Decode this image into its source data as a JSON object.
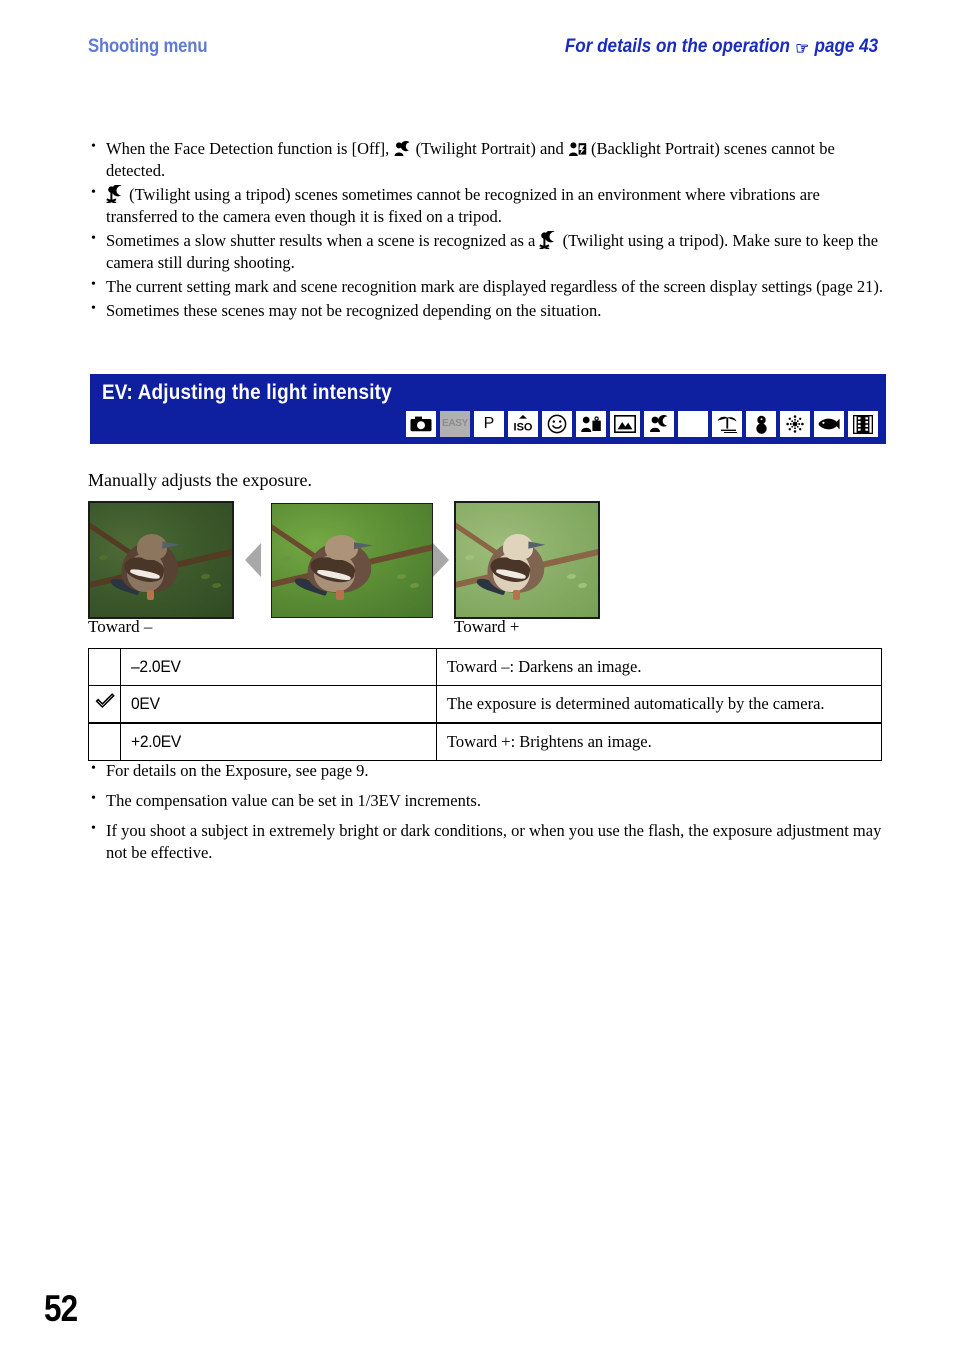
{
  "header": {
    "left_title": "Shooting menu",
    "right_title_a": "For details on the operation",
    "hand_icon": "☞",
    "right_title_b": "page 43"
  },
  "notes_top": [
    "When the Face Detection function is [Off],  (Twilight Portrait) and  (Backlight Portrait) scenes cannot be detected.",
    "(Twilight using a tripod) scenes sometimes cannot be recognized in an environment where vibrations are transferred to the camera even though it is fixed on a tripod.",
    "Sometimes a slow shutter results when a scene is recognized as a (Twilight using a tripod). Make sure to keep the camera still during shooting.",
    "The current setting mark and scene recognition mark are displayed regardless of the screen display settings (page 21).",
    "Sometimes these scenes may not be recognized depending on the situation."
  ],
  "notes_top_parts": {
    "b1_p1": "When the Face Detection function is [Off],",
    "b1_p2": "(Twilight Portrait) and",
    "b1_p3": "(Backlight Portrait) scenes cannot be detected.",
    "b2_p1": "(Twilight using a tripod) scenes sometimes cannot be recognized in an environment where vibrations are transferred to the camera even though it is fixed on a tripod.",
    "b3_p1": "Sometimes a slow shutter results when a scene is recognized as a",
    "b3_p2": "(Twilight using a tripod). Make sure to keep the camera still during shooting.",
    "b4": "The current setting mark and scene recognition mark are displayed regardless of the screen display settings (page 21).",
    "b5": "Sometimes these scenes may not be recognized depending on the situation."
  },
  "section": {
    "title": "EV: Adjusting the light intensity",
    "banner_color": "#0e20a0",
    "modes": [
      {
        "name": "still-shooting",
        "label": "",
        "enabled": true
      },
      {
        "name": "easy-shooting",
        "label": "EASY",
        "enabled": false
      },
      {
        "name": "program-auto",
        "label": "P",
        "enabled": true
      },
      {
        "name": "high-sensitivity",
        "label": "ISO",
        "enabled": true
      },
      {
        "name": "smile-shutter",
        "label": "",
        "enabled": true
      },
      {
        "name": "soft-snap",
        "label": "",
        "enabled": true
      },
      {
        "name": "landscape",
        "label": "",
        "enabled": true
      },
      {
        "name": "twilight-portrait",
        "label": "",
        "enabled": true
      },
      {
        "name": "twilight",
        "label": "",
        "enabled": true
      },
      {
        "name": "beach",
        "label": "",
        "enabled": true
      },
      {
        "name": "snow",
        "label": "",
        "enabled": true
      },
      {
        "name": "fireworks",
        "label": "",
        "enabled": true
      },
      {
        "name": "underwater",
        "label": "",
        "enabled": true
      },
      {
        "name": "movie",
        "label": "",
        "enabled": true
      }
    ]
  },
  "lead_line": "Manually adjusts the exposure.",
  "photos": {
    "caption_minus": "Toward –",
    "caption_plus": "Toward +",
    "samples": [
      {
        "name": "darkened-sample",
        "variant": "dark"
      },
      {
        "name": "normal-sample",
        "variant": "normal"
      },
      {
        "name": "brightened-sample",
        "variant": "bright"
      }
    ]
  },
  "ev_table": {
    "check_glyph": "✓",
    "rows": [
      {
        "selected": false,
        "value": "–2.0EV",
        "description": "Toward –: Darkens an image."
      },
      {
        "selected": true,
        "value": "0EV",
        "description": "The exposure is determined automatically by the camera."
      },
      {
        "selected": false,
        "value": "+2.0EV",
        "description": "Toward +: Brightens an image."
      }
    ]
  },
  "notes_bottom": [
    "For details on the Exposure, see page 9.",
    "The compensation value can be set in 1/3EV increments.",
    "If you shoot a subject in extremely bright or dark conditions, or when you use the flash, the exposure adjustment may not be effective."
  ],
  "page_number": "52"
}
